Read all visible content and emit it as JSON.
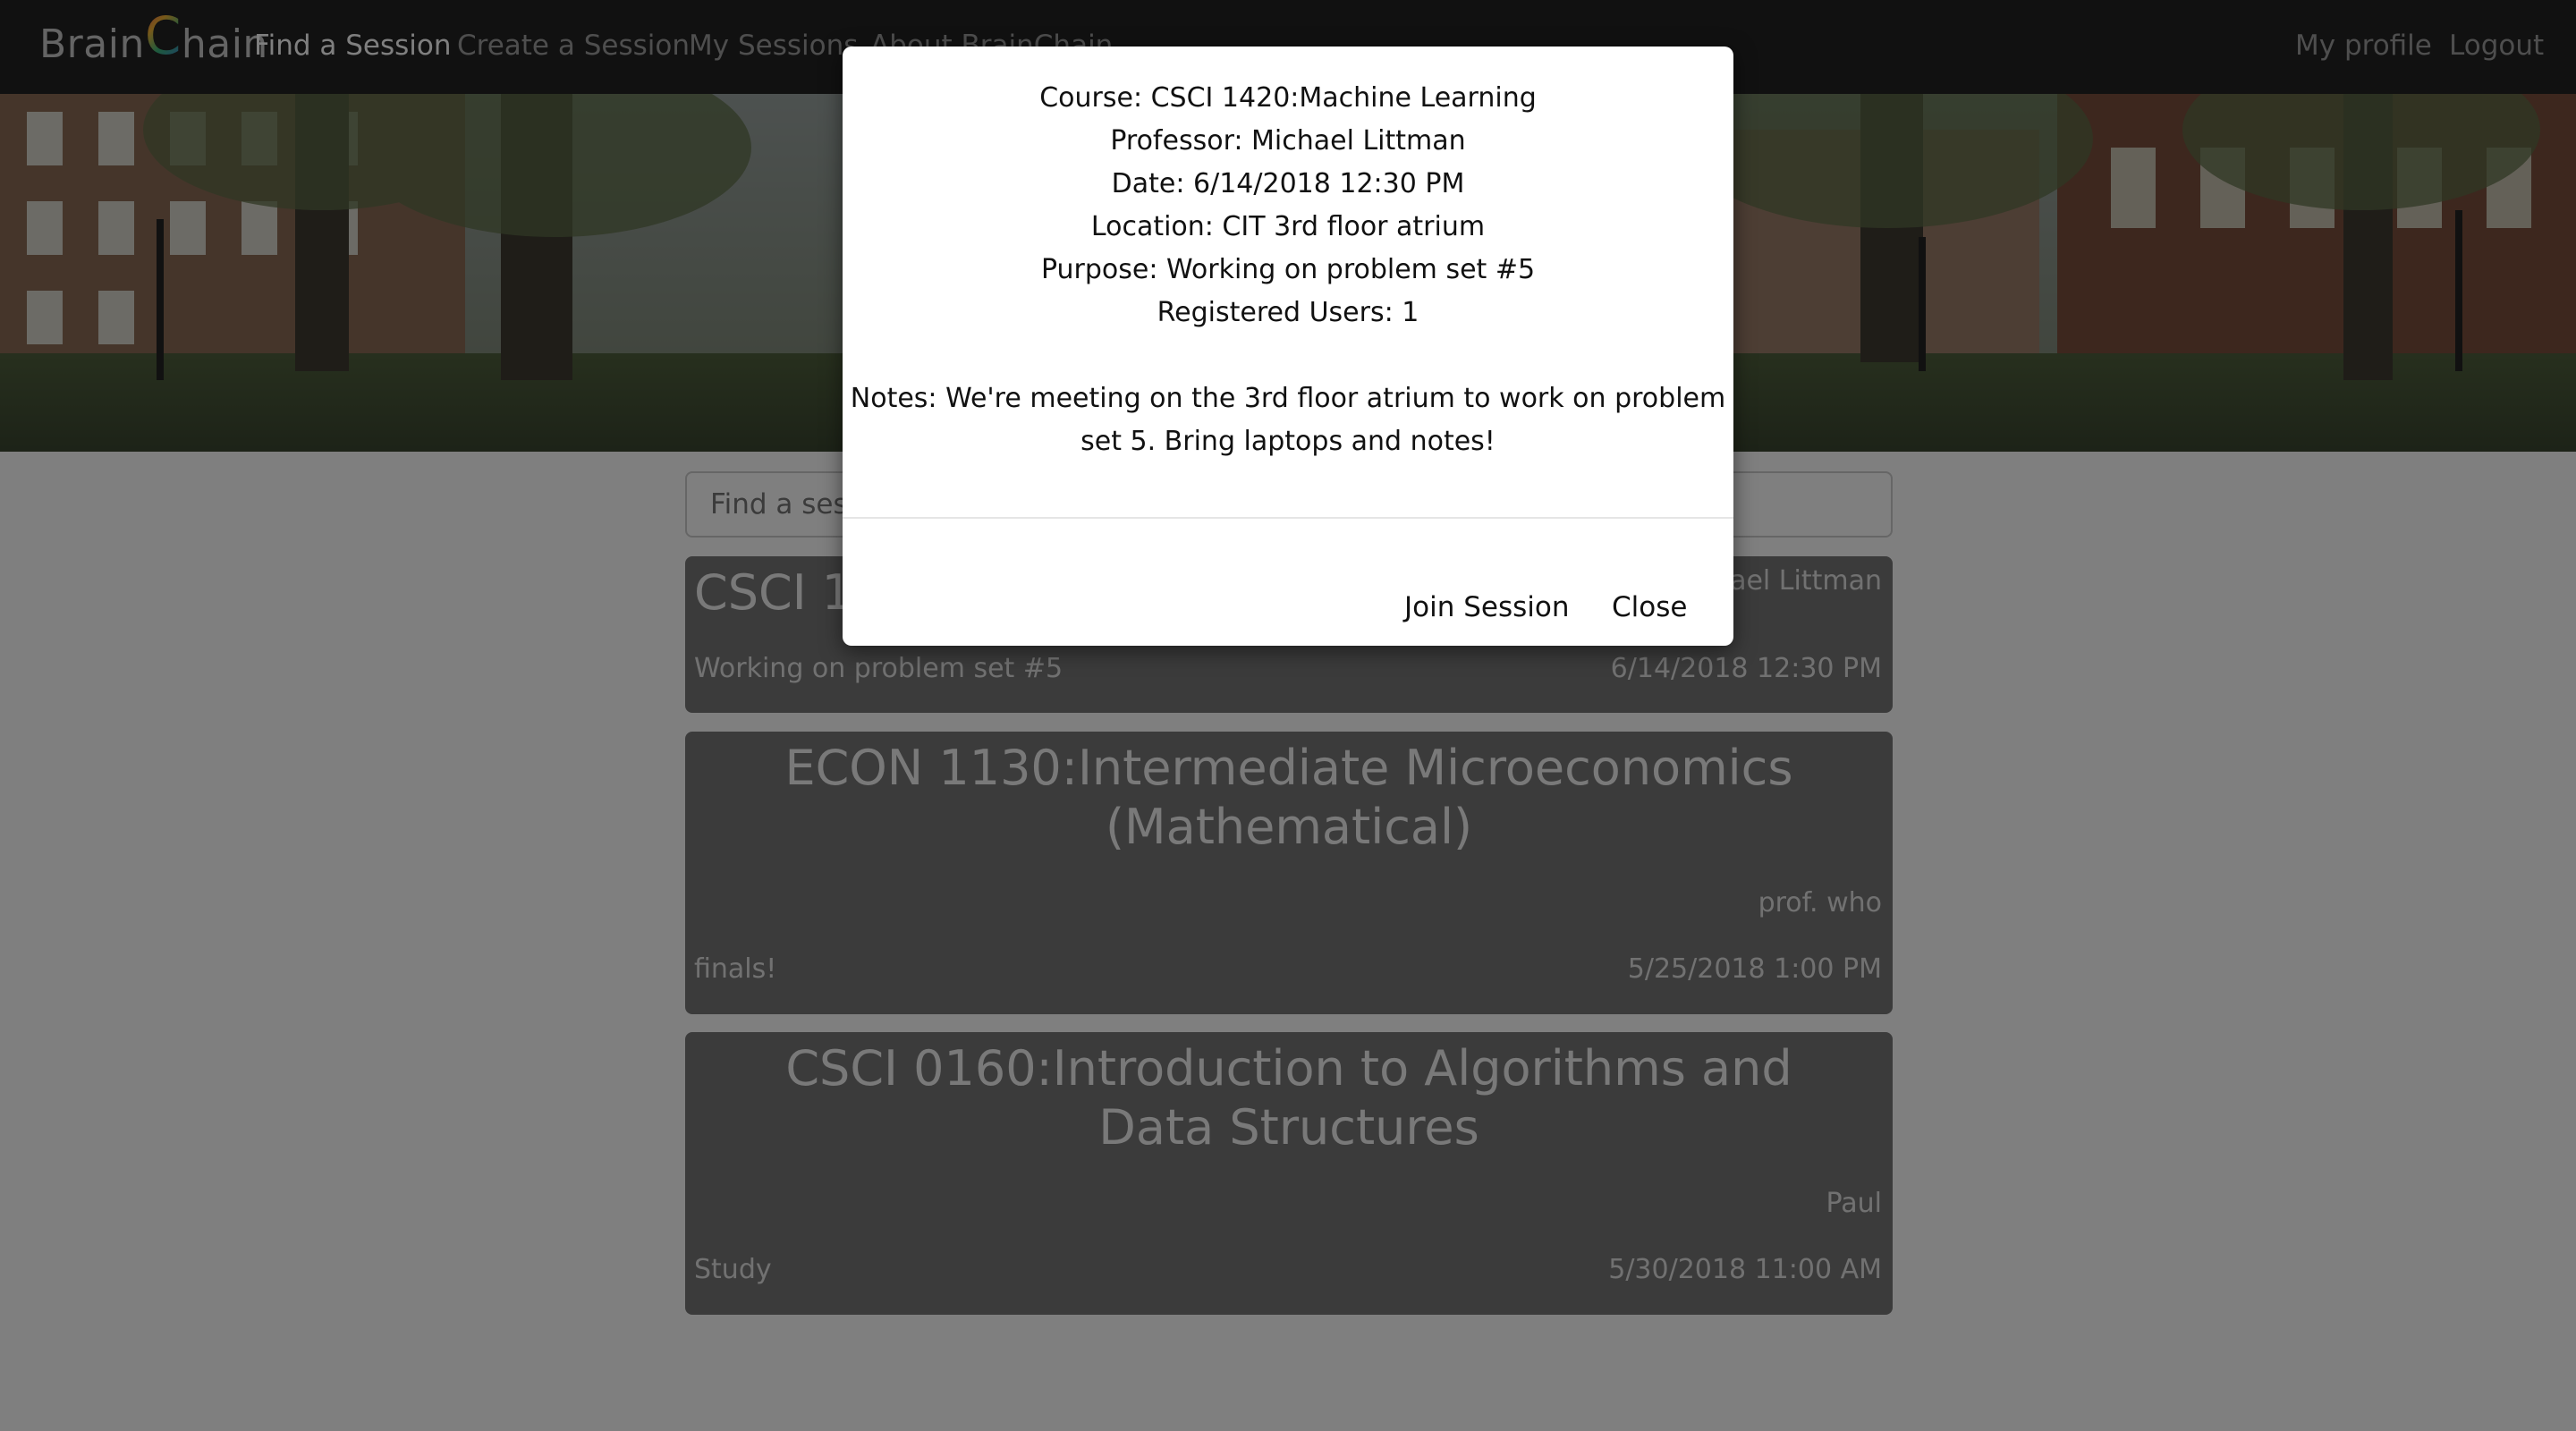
{
  "nav": {
    "brand_left": "Brain",
    "brand_c": "C",
    "brand_right": "hain",
    "find": "Find a Session",
    "create": "Create a Session",
    "my_sessions": "My Sessions",
    "about": "About BrainChain",
    "profile": "My profile",
    "logout": "Logout"
  },
  "search": {
    "placeholder": "Find a session..."
  },
  "sessions": [
    {
      "course": "CSCI 1420:Machine Learning",
      "professor": "Michael Littman",
      "purpose": "Working on problem set #5",
      "date": "6/14/2018 12:30 PM"
    },
    {
      "course": "ECON 1130:Intermediate Microeconomics (Mathematical)",
      "professor": "prof. who",
      "purpose": "finals!",
      "date": "5/25/2018 1:00 PM"
    },
    {
      "course": "CSCI 0160:Introduction to Algorithms and Data Structures",
      "professor": "Paul",
      "purpose": "Study",
      "date": "5/30/2018 11:00 AM"
    }
  ],
  "modal": {
    "course": "Course: CSCI 1420:Machine Learning",
    "professor": "Professor: Michael Littman",
    "date": "Date: 6/14/2018 12:30 PM",
    "location": "Location: CIT 3rd floor atrium",
    "purpose": "Purpose: Working on problem set #5",
    "registered": "Registered Users: 1",
    "notes_line1": "Notes: We're meeting on the 3rd floor atrium to work on problem",
    "notes_line2": "set 5. Bring laptops and notes!",
    "join_label": "Join Session",
    "close_label": "Close"
  },
  "colors": {
    "navbar_bg": "#222222",
    "card_bg": "#777777",
    "nav_active": "#ffffff",
    "nav_inactive": "#9d9d9d"
  },
  "icons": {
    "brand_logo": "brainchain-logo"
  }
}
